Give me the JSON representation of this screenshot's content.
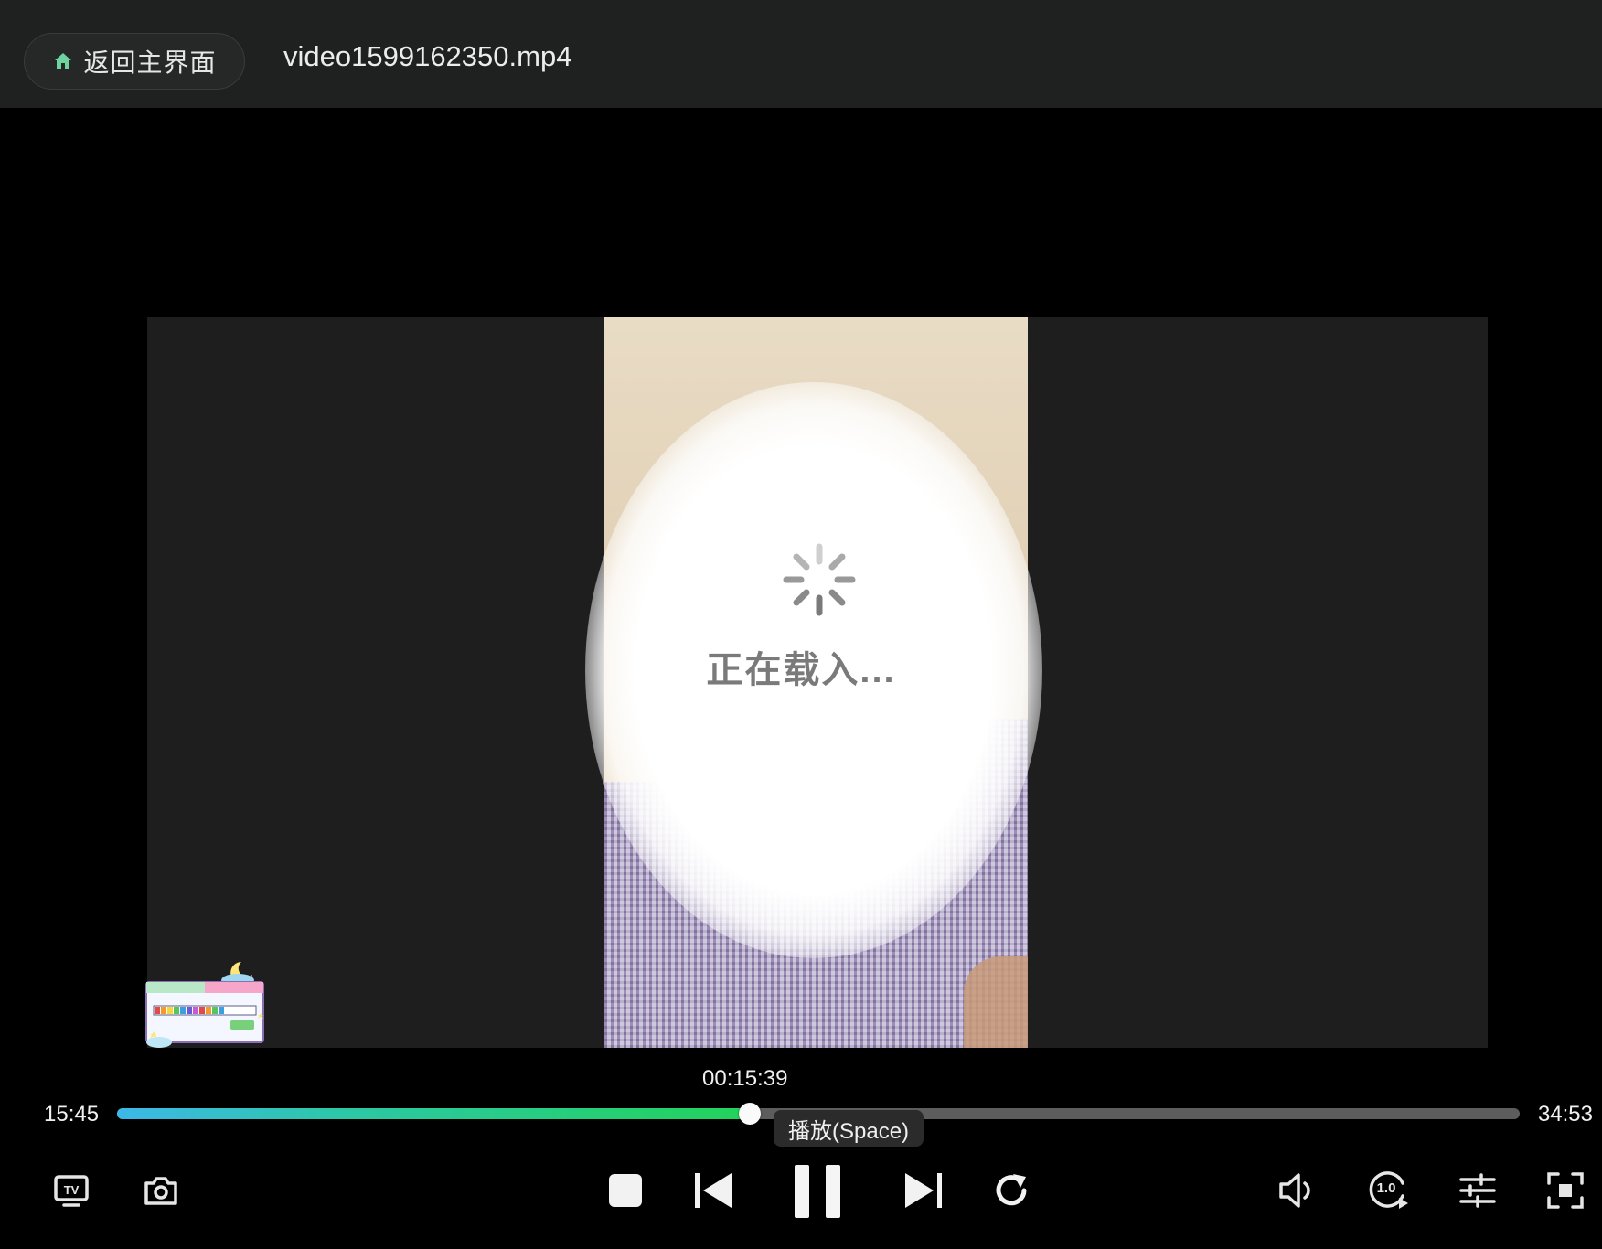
{
  "titlebar": {
    "home_label": "返回主界面",
    "file_name": "video1599162350.mp4"
  },
  "player": {
    "loading_text": "正在载入...",
    "state": "loading"
  },
  "seek": {
    "hover_time": "00:15:39",
    "current_time": "15:45",
    "total_time": "34:53",
    "progress": 0.451,
    "hint": "播放(Space)"
  },
  "controls": {
    "left": [
      "tv-cast-icon",
      "screenshot-camera-icon"
    ],
    "center": [
      "stop-icon",
      "previous-icon",
      "pause-icon",
      "next-icon",
      "replay-icon"
    ],
    "right": [
      "volume-icon",
      "playback-speed-icon",
      "equalizer-icon",
      "fullscreen-icon"
    ],
    "speed_label": "1.0"
  },
  "colors": {
    "titlebar_bg": "#1f2020",
    "progress_start": "#3db8e8",
    "progress_end": "#22d35a",
    "home_icon": "#6fd3a0"
  }
}
